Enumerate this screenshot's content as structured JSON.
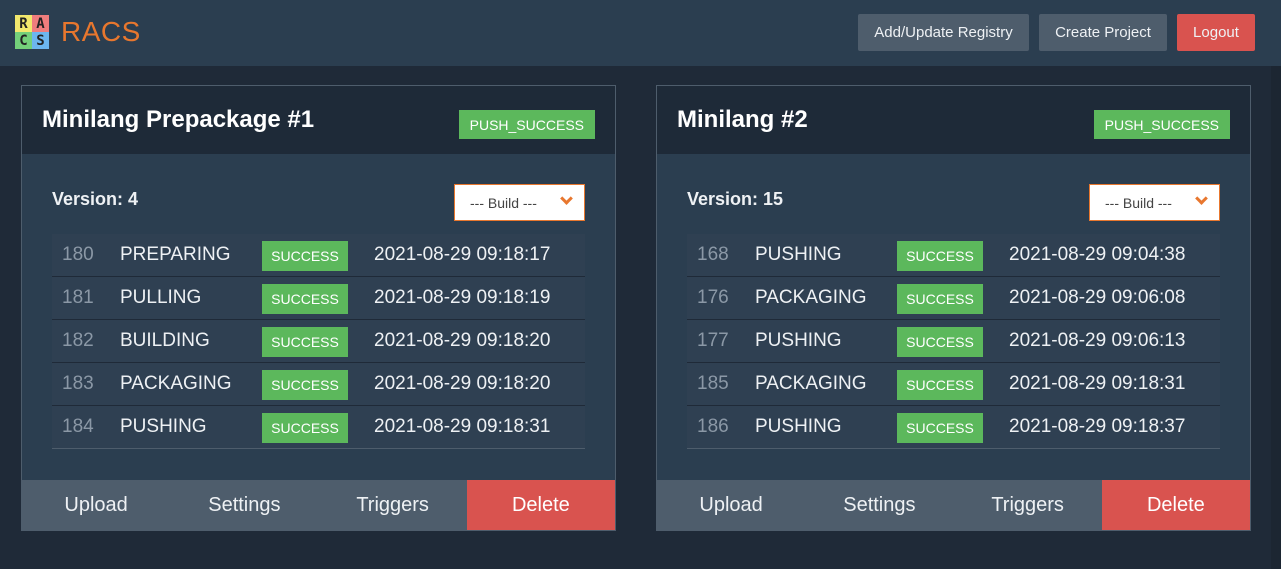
{
  "app": {
    "logo_letters": [
      "R",
      "A",
      "C",
      "S"
    ],
    "name": "RACS",
    "colors": {
      "accent": "#e8772e",
      "success": "#5cb85c",
      "danger": "#d9534f",
      "navbar": "#2b3e50",
      "background": "#1f2a38"
    }
  },
  "nav": {
    "registry_label": "Add/Update Registry",
    "create_label": "Create Project",
    "logout_label": "Logout"
  },
  "projects": [
    {
      "title": "Minilang Prepackage #1",
      "status": "PUSH_SUCCESS",
      "version": "Version: 4",
      "build_select": "--- Build ---",
      "builds": [
        {
          "id": "180",
          "stage": "PREPARING",
          "status": "SUCCESS",
          "time": "2021-08-29 09:18:17"
        },
        {
          "id": "181",
          "stage": "PULLING",
          "status": "SUCCESS",
          "time": "2021-08-29 09:18:19"
        },
        {
          "id": "182",
          "stage": "BUILDING",
          "status": "SUCCESS",
          "time": "2021-08-29 09:18:20"
        },
        {
          "id": "183",
          "stage": "PACKAGING",
          "status": "SUCCESS",
          "time": "2021-08-29 09:18:20"
        },
        {
          "id": "184",
          "stage": "PUSHING",
          "status": "SUCCESS",
          "time": "2021-08-29 09:18:31"
        }
      ],
      "actions": {
        "upload": "Upload",
        "settings": "Settings",
        "triggers": "Triggers",
        "delete": "Delete"
      }
    },
    {
      "title": "Minilang #2",
      "status": "PUSH_SUCCESS",
      "version": "Version: 15",
      "build_select": "--- Build ---",
      "builds": [
        {
          "id": "168",
          "stage": "PUSHING",
          "status": "SUCCESS",
          "time": "2021-08-29 09:04:38"
        },
        {
          "id": "176",
          "stage": "PACKAGING",
          "status": "SUCCESS",
          "time": "2021-08-29 09:06:08"
        },
        {
          "id": "177",
          "stage": "PUSHING",
          "status": "SUCCESS",
          "time": "2021-08-29 09:06:13"
        },
        {
          "id": "185",
          "stage": "PACKAGING",
          "status": "SUCCESS",
          "time": "2021-08-29 09:18:31"
        },
        {
          "id": "186",
          "stage": "PUSHING",
          "status": "SUCCESS",
          "time": "2021-08-29 09:18:37"
        }
      ],
      "actions": {
        "upload": "Upload",
        "settings": "Settings",
        "triggers": "Triggers",
        "delete": "Delete"
      }
    }
  ]
}
